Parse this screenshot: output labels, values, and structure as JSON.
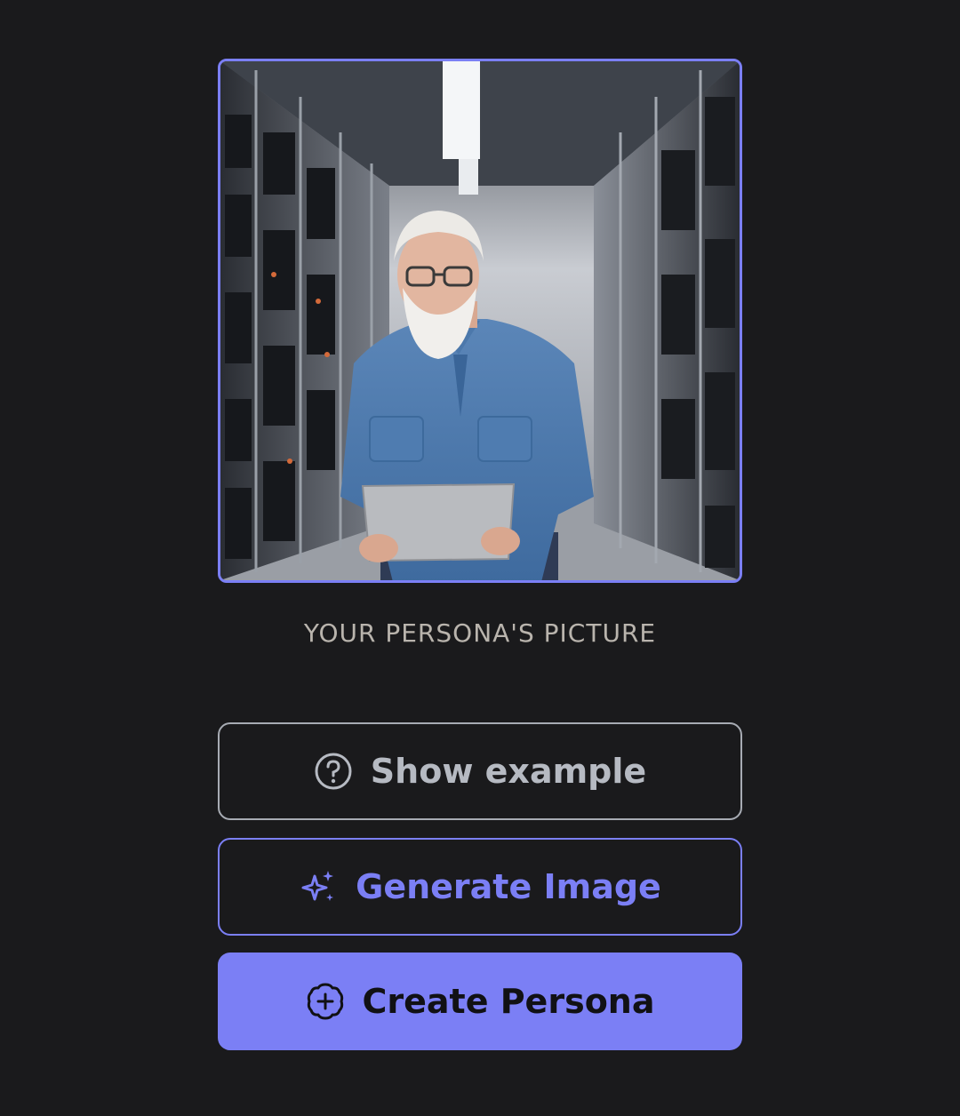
{
  "persona": {
    "picture_alt": "Persona picture: older man with white beard and glasses in a blue shirt holding a laptop in a server room",
    "caption": "YOUR PERSONA'S PICTURE"
  },
  "actions": {
    "show_example": {
      "label": "Show example",
      "icon": "question-circle-icon"
    },
    "generate_image": {
      "label": "Generate Image",
      "icon": "sparkles-icon"
    },
    "create_persona": {
      "label": "Create Persona",
      "icon": "plus-circle-icon"
    }
  },
  "colors": {
    "background": "#1a1a1c",
    "accent": "#7b7ff5",
    "muted_text": "#b6bac2",
    "caption_text": "#b9b4ad"
  }
}
